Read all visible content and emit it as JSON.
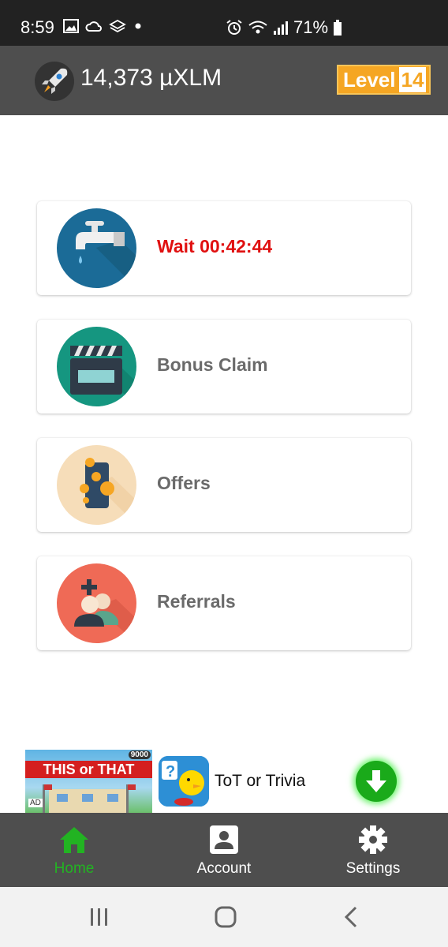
{
  "status_bar": {
    "time": "8:59",
    "battery": "71%",
    "icons": [
      "image-icon",
      "cloud-icon",
      "layers-icon",
      "dot-icon",
      "alarm-icon",
      "wifi-icon",
      "signal-icon",
      "battery-icon"
    ]
  },
  "header": {
    "balance": "14,373 µXLM",
    "level_label": "Level",
    "level_number": "14",
    "logo_icon": "rocket-icon"
  },
  "cards": [
    {
      "label": "Wait 00:42:44",
      "icon": "faucet-icon",
      "color": "#1b6b97"
    },
    {
      "label": "Bonus Claim",
      "icon": "clapperboard-icon",
      "color": "#159680"
    },
    {
      "label": "Offers",
      "icon": "phone-coins-icon",
      "color": "#f6ddb9"
    },
    {
      "label": "Referrals",
      "icon": "add-users-icon",
      "color": "#ef6a56"
    }
  ],
  "ad": {
    "banner_title": "THIS or THAT",
    "banner_score": "9000",
    "ad_tag": "AD",
    "app_name": "ToT or Trivia"
  },
  "bottom_nav": [
    {
      "label": "Home",
      "icon": "home-icon",
      "active": true
    },
    {
      "label": "Account",
      "icon": "account-icon",
      "active": false
    },
    {
      "label": "Settings",
      "icon": "gear-icon",
      "active": false
    }
  ],
  "colors": {
    "wait_red": "#e01010",
    "active_green": "#22b322",
    "level_orange": "#f5a623",
    "bar_gray": "#4e4e4e"
  }
}
